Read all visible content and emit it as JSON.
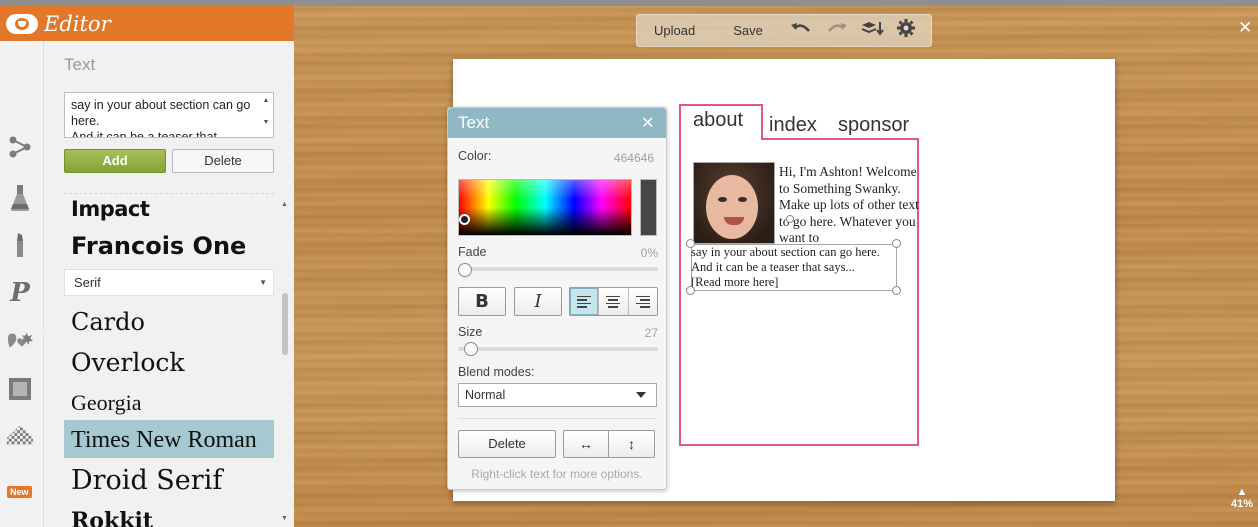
{
  "app": {
    "title": "Editor"
  },
  "panel": {
    "title": "Text",
    "textarea_value": "say in your about section can go here.\nAnd it can be a teaser that",
    "add_label": "Add",
    "delete_label": "Delete",
    "category_select": "Serif",
    "fonts": [
      "Impact",
      "Francois One",
      "Cardo",
      "Overlock",
      "Georgia",
      "Times New Roman",
      "Droid Serif",
      "Rokkit"
    ],
    "selected_font": "Times New Roman"
  },
  "rail": {
    "icons": [
      "effects-icon",
      "touchup-icon",
      "cosmetic-icon",
      "text-icon",
      "overlays-icon",
      "frames-icon",
      "textures-icon"
    ],
    "new_badge": "New"
  },
  "toolbar": {
    "upload_label": "Upload",
    "save_label": "Save",
    "icons": [
      "undo-icon",
      "redo-icon",
      "layers-icon",
      "settings-icon"
    ]
  },
  "canvas": {
    "close_symbol": "✕",
    "zoom": "41%",
    "tabs": [
      "about",
      "index",
      "sponsor"
    ],
    "about_text_top": "Hi, I'm Ashton! Welcome to Something Swanky. Make up lots of other text to go here. Whatever you want to",
    "about_text_bottom": "say in your about section can go here.\nAnd it can be a teaser that says...\n[Read more here]"
  },
  "text_dialog": {
    "title": "Text",
    "color_label": "Color:",
    "color_value": "464646",
    "current_color": "#464646",
    "fade_label": "Fade",
    "fade_value": "0%",
    "fade_level": 0,
    "bold_label": "B",
    "italic_label": "I",
    "alignment": "left",
    "size_label": "Size",
    "size_value": "27",
    "blend_label": "Blend modes:",
    "blend_value": "Normal",
    "delete_label": "Delete",
    "hint": "Right-click text for more options."
  },
  "colors": {
    "header": "#e3782b",
    "add_button": "#95b547",
    "dialog_header": "#8fb8c4",
    "tab_border": "#e0578f",
    "selected_font_bg": "#a6c9d1"
  }
}
